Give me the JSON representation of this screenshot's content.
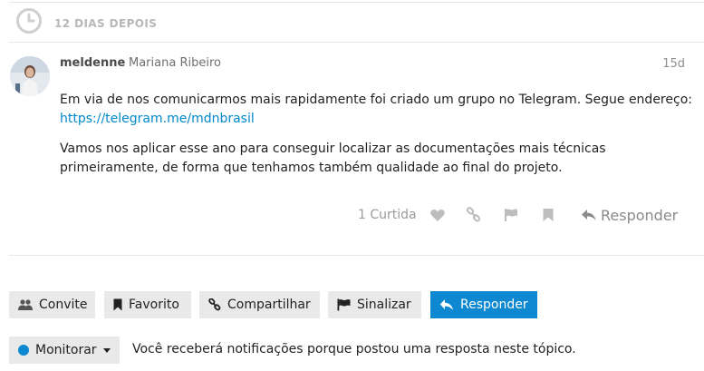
{
  "time_gap": {
    "label": "12 DIAS DEPOIS",
    "icon": "clock-icon"
  },
  "post": {
    "username": "meldenne",
    "full_name": "Mariana Ribeiro",
    "date": "15d",
    "paragraph_1": "Em via de nos comunicarmos mais rapidamente foi criado um grupo no Telegram. Segue endereço:",
    "link": "https://telegram.me/mdnbrasil",
    "paragraph_2": "Vamos nos aplicar esse ano para conseguir localizar as documentações mais técnicas primeiramente, de forma que tenhamos também qualidade ao final do projeto.",
    "actions": {
      "like_count": "1 Curtida",
      "reply_label": "Responder",
      "icons": [
        "heart-icon",
        "link-icon",
        "flag-icon",
        "bookmark-icon",
        "reply-icon"
      ]
    }
  },
  "footer_buttons": {
    "invite": "Convite",
    "bookmark": "Favorito",
    "share": "Compartilhar",
    "flag": "Sinalizar",
    "reply": "Responder"
  },
  "notifications": {
    "level": "Monitorar",
    "description": "Você receberá notificações porque postou uma resposta neste tópico."
  },
  "colors": {
    "accent": "#0e88d0",
    "link": "#0088cc",
    "muted": "#9a9a9a",
    "button_bg": "#e9e9e9"
  }
}
